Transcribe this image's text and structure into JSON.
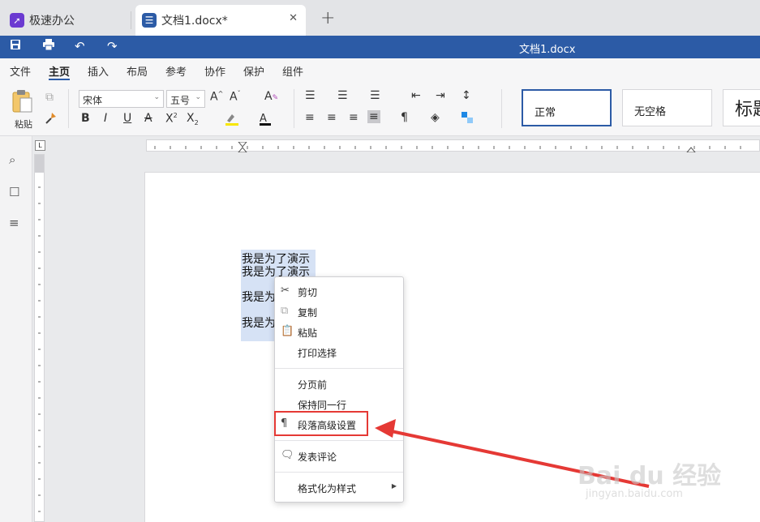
{
  "tabs": {
    "app_label": "极速办公",
    "doc_label": "文档1.docx*",
    "new_tab": "+",
    "close": "✕"
  },
  "titlebar": {
    "title": "文档1.docx"
  },
  "menu": [
    "文件",
    "主页",
    "插入",
    "布局",
    "参考",
    "协作",
    "保护",
    "组件"
  ],
  "ribbon": {
    "paste_label": "粘贴",
    "font_name": "宋体",
    "font_size": "五号",
    "styles": [
      "正常",
      "无空格",
      "标题"
    ]
  },
  "document": {
    "lines": [
      "我是为了演示",
      "我是为了演示",
      "我是为",
      "我是为"
    ]
  },
  "context_menu": {
    "items": [
      "剪切",
      "复制",
      "粘贴",
      "打印选择",
      "分页前",
      "保持同一行",
      "段落高级设置",
      "发表评论",
      "格式化为样式"
    ]
  },
  "watermark": {
    "brand": "Bai du 经验",
    "url": "jingyan.baidu.com"
  },
  "colors": {
    "accent": "#2c5ba6",
    "highlight": "#e53935",
    "selection": "#d6e2f5"
  }
}
